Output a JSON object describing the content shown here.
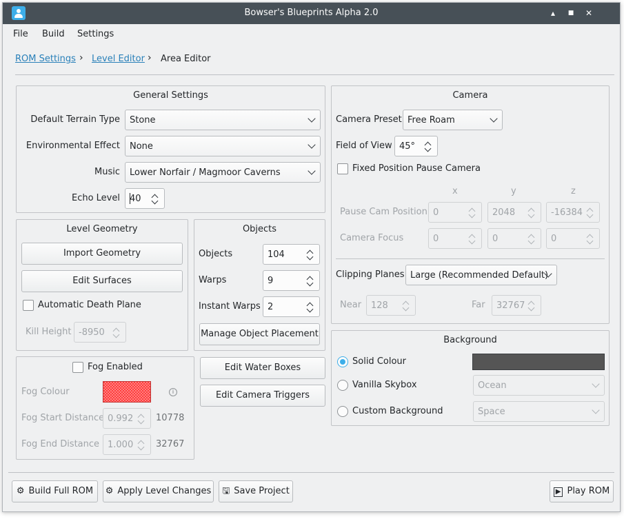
{
  "window": {
    "title": "Bowser's Blueprints Alpha 2.0",
    "controls": {
      "minimize": "▴",
      "maximize": "■",
      "close": "✕"
    }
  },
  "menu": {
    "file": "File",
    "build": "Build",
    "settings": "Settings"
  },
  "breadcrumb": {
    "rom_settings": "ROM Settings",
    "level_editor": "Level Editor",
    "area_editor": "Area Editor",
    "separator": "›"
  },
  "general_settings": {
    "title": "General Settings",
    "terrain_label": "Default Terrain Type",
    "terrain_value": "Stone",
    "effect_label": "Environmental Effect",
    "effect_value": "None",
    "music_label": "Music",
    "music_value": "Lower Norfair / Magmoor Caverns",
    "echo_label": "Echo Level",
    "echo_value": "40"
  },
  "level_geometry": {
    "title": "Level Geometry",
    "import_button": "Import Geometry",
    "edit_surfaces_button": "Edit Surfaces",
    "death_plane_label": "Automatic Death Plane",
    "death_plane_checked": false,
    "kill_height_label": "Kill Height",
    "kill_height_value": "-8950"
  },
  "objects": {
    "title": "Objects",
    "objects_label": "Objects",
    "objects_value": "104",
    "warps_label": "Warps",
    "warps_value": "9",
    "instant_warps_label": "Instant Warps",
    "instant_warps_value": "2",
    "manage_button": "Manage Object Placement"
  },
  "fog": {
    "enabled_label": "Fog Enabled",
    "enabled_checked": false,
    "colour_label": "Fog Colour",
    "colour_value": "#ff3d3d",
    "info_icon": "i",
    "start_label": "Fog Start Distance",
    "start_value": "0.992",
    "start_computed": "10778",
    "end_label": "Fog End Distance",
    "end_value": "1.000",
    "end_computed": "32767"
  },
  "water": {
    "edit_water_button": "Edit Water Boxes",
    "edit_camera_triggers_button": "Edit Camera Triggers"
  },
  "camera": {
    "title": "Camera",
    "preset_label": "Camera Preset",
    "preset_value": "Free Roam",
    "fov_label": "Field of View",
    "fov_value": "45°",
    "fixed_pause_label": "Fixed Position Pause Camera",
    "fixed_pause_checked": false,
    "col_x": "x",
    "col_y": "y",
    "col_z": "z",
    "pause_pos_label": "Pause Cam Position",
    "pause_pos_x": "0",
    "pause_pos_y": "2048",
    "pause_pos_z": "-16384",
    "focus_label": "Camera Focus",
    "focus_x": "0",
    "focus_y": "0",
    "focus_z": "0",
    "clipping_label": "Clipping Planes",
    "clipping_value": "Large (Recommended Default)",
    "near_label": "Near",
    "near_value": "128",
    "far_label": "Far",
    "far_value": "32767"
  },
  "background": {
    "title": "Background",
    "solid_label": "Solid Colour",
    "solid_selected": true,
    "solid_colour": "#555555",
    "vanilla_label": "Vanilla Skybox",
    "vanilla_value": "Ocean",
    "custom_label": "Custom Background",
    "custom_value": "Space"
  },
  "bottom_bar": {
    "build_full_rom": "Build Full ROM",
    "apply_level_changes": "Apply Level Changes",
    "save_project": "Save Project",
    "play_rom": "Play ROM"
  },
  "colors": {
    "accent": "#3daee9",
    "link": "#2980b9",
    "titlebar": "#475057"
  }
}
